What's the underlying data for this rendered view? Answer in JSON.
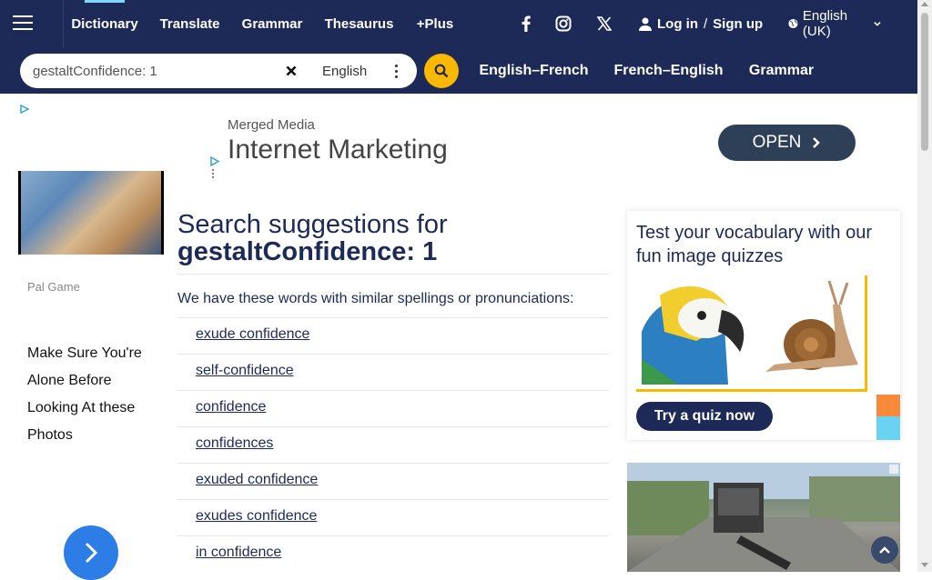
{
  "header": {
    "nav": [
      {
        "label": "Dictionary"
      },
      {
        "label": "Translate"
      },
      {
        "label": "Grammar"
      },
      {
        "label": "Thesaurus"
      },
      {
        "label": "+Plus"
      }
    ],
    "social_icons": [
      "facebook-icon",
      "instagram-icon",
      "x-icon"
    ],
    "login_label": "Log in",
    "slash": "/",
    "signup_label": "Sign up",
    "language": "English (UK)"
  },
  "search": {
    "value": "gestaltConfidence: 1",
    "dictionary": "English"
  },
  "quick_links": [
    "English–French",
    "French–English",
    "Grammar"
  ],
  "left_ad": {
    "source": "Pal Game",
    "headline": "Make Sure You're Alone Before Looking At these Photos"
  },
  "banner_ad": {
    "brand": "Merged Media",
    "title": "Internet Marketing",
    "cta": "OPEN"
  },
  "results": {
    "title_prefix": "Search suggestions for",
    "query": "gestaltConfidence: 1",
    "intro": "We have these words with similar spellings or pronunciations:",
    "suggestions": [
      "exude confidence",
      "self-confidence",
      "confidence",
      "confidences",
      "exuded confidence",
      "exudes confidence",
      "in confidence"
    ]
  },
  "quiz": {
    "title": "Test your vocabulary with our fun image quizzes",
    "button": "Try a quiz now"
  },
  "colors": {
    "brand_navy": "#1d2a57",
    "accent_yellow": "#fbb800",
    "active_tab": "#7dd7f5"
  }
}
